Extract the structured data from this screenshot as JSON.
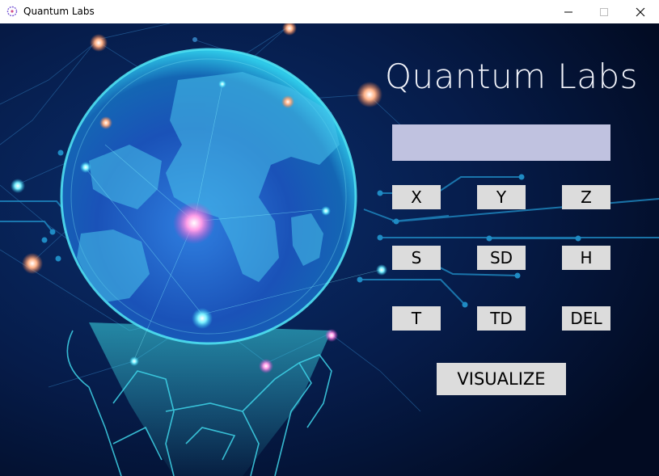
{
  "window": {
    "title": "Quantum Labs",
    "controls": {
      "minimize": "—",
      "maximize": "☐",
      "close": "✕"
    }
  },
  "app": {
    "title": "Quantum Labs",
    "display_value": "",
    "gates": {
      "x": "X",
      "y": "Y",
      "z": "Z",
      "s": "S",
      "sd": "SD",
      "h": "H",
      "t": "T",
      "td": "TD",
      "del": "DEL"
    },
    "visualize_label": "VISUALIZE"
  },
  "colors": {
    "background": "#03122f",
    "display_fill": "#c0c2e0",
    "button_fill": "#dcdcdc",
    "title_text": "#f2f4fb",
    "globe_glow": "#29c6e6"
  },
  "icons": [
    "app-icon",
    "minimize-icon",
    "maximize-icon",
    "close-icon"
  ]
}
